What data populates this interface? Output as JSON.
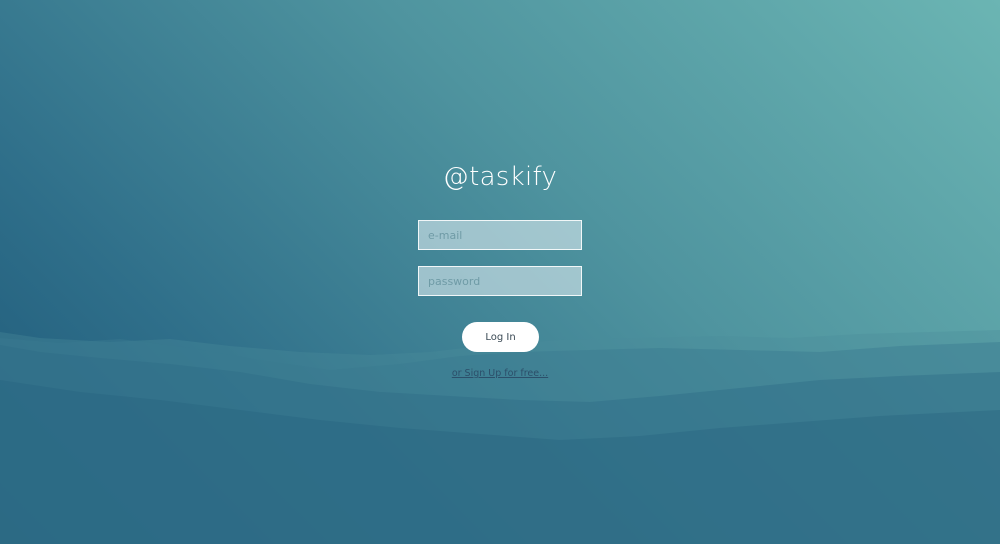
{
  "app": {
    "title": "@taskify"
  },
  "login_form": {
    "email_placeholder": "e-mail",
    "password_placeholder": "password",
    "login_label": "Log In",
    "signup_label": "or Sign Up for free..."
  },
  "colors": {
    "background_light": "#6bb5b3",
    "background_dark": "#1d5878",
    "button_bg": "#ffffff",
    "link": "#2c4f6a"
  }
}
